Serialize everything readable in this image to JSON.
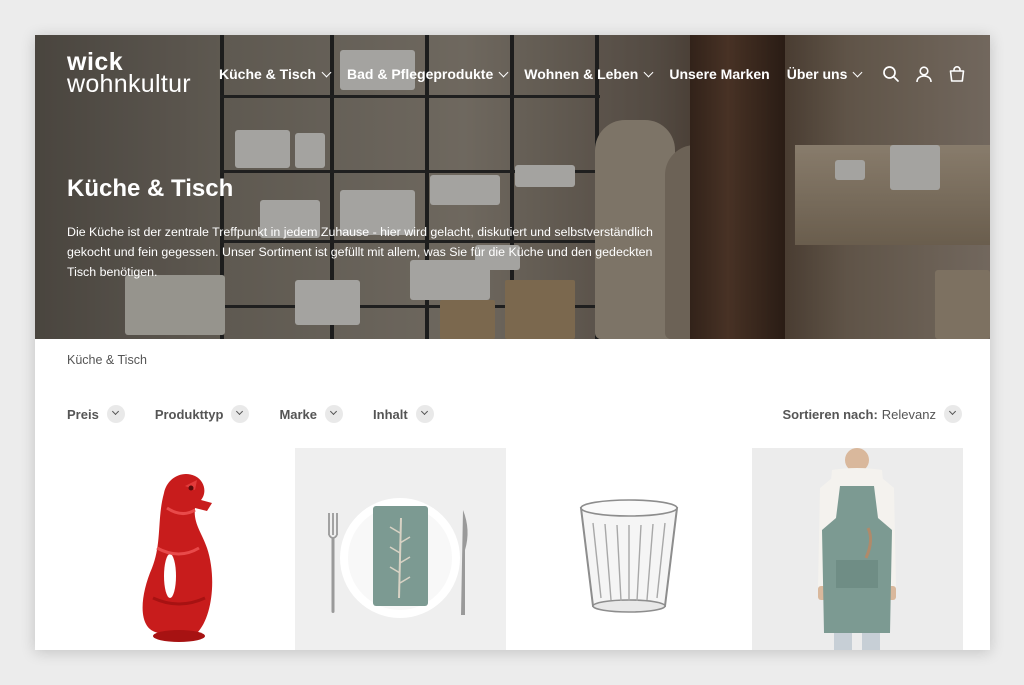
{
  "brand": {
    "line1": "wick",
    "line2": "wohnkultur"
  },
  "nav": [
    {
      "label": "Küche & Tisch",
      "has_dropdown": true
    },
    {
      "label": "Bad & Pflegeprodukte",
      "has_dropdown": true
    },
    {
      "label": "Wohnen & Leben",
      "has_dropdown": true
    },
    {
      "label": "Unsere Marken",
      "has_dropdown": false
    },
    {
      "label": "Über uns",
      "has_dropdown": true
    }
  ],
  "header_icons": [
    "search-icon",
    "account-icon",
    "cart-icon"
  ],
  "hero": {
    "title": "Küche & Tisch",
    "text": "Die Küche ist der zentrale Treffpunkt in jedem Zuhause - hier wird gelacht, diskutiert und selbstverständlich gekocht und fein gegessen. Unser Sortiment ist gefüllt mit allem, was Sie für die Küche und den gedeckten Tisch benötigen."
  },
  "breadcrumb": "Küche & Tisch",
  "filters": [
    {
      "label": "Preis"
    },
    {
      "label": "Produkttyp"
    },
    {
      "label": "Marke"
    },
    {
      "label": "Inhalt"
    }
  ],
  "sort": {
    "label": "Sortieren nach:",
    "value": "Relevanz"
  },
  "products": [
    {
      "image": "red fish-shaped jug"
    },
    {
      "image": "plate with napkin, fork and knife"
    },
    {
      "image": "glass tumbler"
    },
    {
      "image": "person wearing linen apron"
    }
  ],
  "colors": {
    "hero_text": "#ffffff",
    "product_red": "#c81c1c",
    "apron_green": "#7c9a92"
  }
}
